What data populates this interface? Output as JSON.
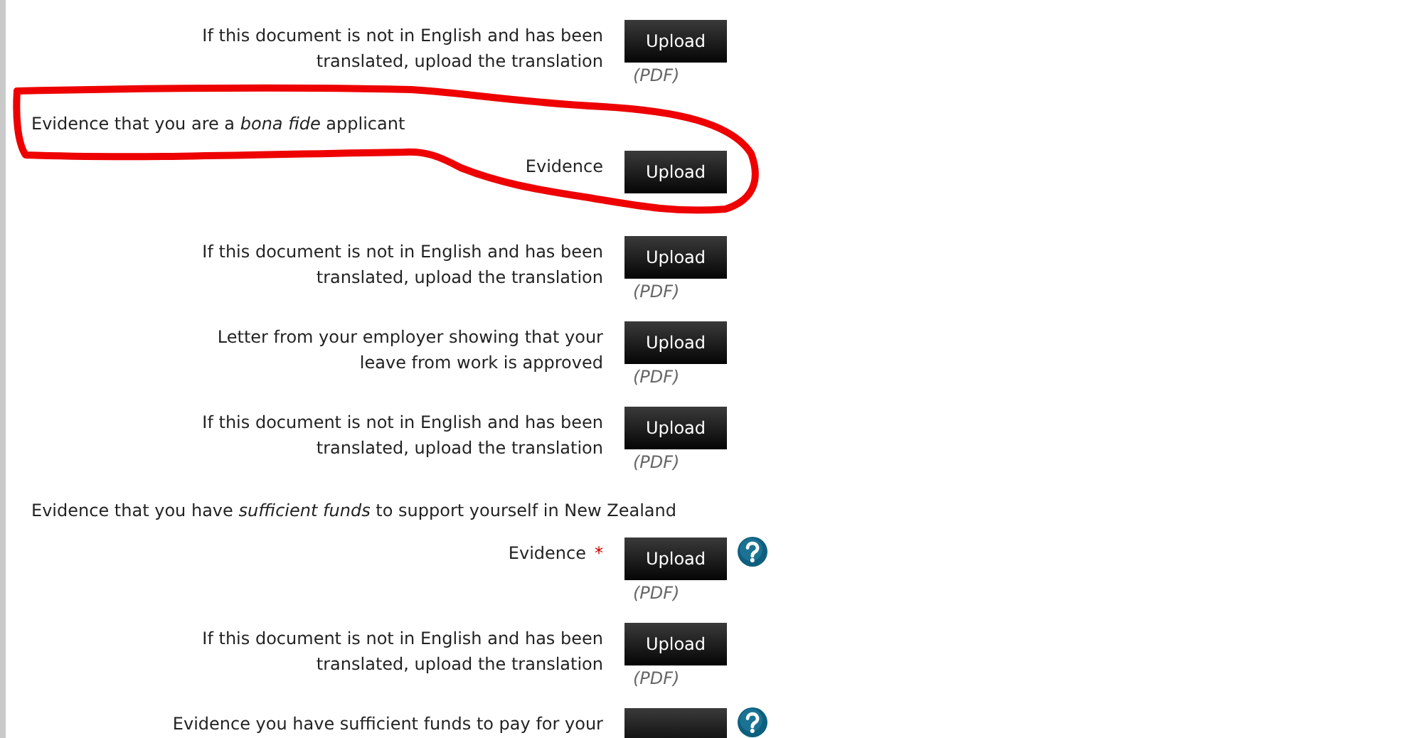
{
  "rows": [
    {
      "kind": "upload",
      "label": "If this document is not in English and has been translated, upload the translation",
      "required": false,
      "button": "Upload",
      "note": "(PDF)",
      "help": false
    },
    {
      "kind": "section",
      "text": "Evidence that you are a *bona fide* applicant"
    },
    {
      "kind": "upload",
      "label": "Evidence",
      "required": false,
      "button": "Upload",
      "help": false
    },
    {
      "kind": "upload",
      "label": "If this document is not in English and has been translated, upload the translation",
      "required": false,
      "button": "Upload",
      "note": "(PDF)",
      "help": false
    },
    {
      "kind": "upload",
      "label": "Letter from your employer showing that your leave from work is approved",
      "required": false,
      "button": "Upload",
      "note": "(PDF)",
      "help": false
    },
    {
      "kind": "upload",
      "label": "If this document is not in English and has been translated, upload the translation",
      "required": false,
      "button": "Upload",
      "note": "(PDF)",
      "help": false
    },
    {
      "kind": "section",
      "text": "Evidence that you have *sufficient funds* to support yourself in New Zealand"
    },
    {
      "kind": "upload",
      "label": "Evidence",
      "required": true,
      "required_mark": "*",
      "button": "Upload",
      "note": "(PDF)",
      "help": true
    },
    {
      "kind": "upload",
      "label": "If this document is not in English and has been translated, upload the translation",
      "required": false,
      "button": "Upload",
      "note": "(PDF)",
      "help": false
    },
    {
      "kind": "upload",
      "label": "Evidence you have sufficient funds to pay for your",
      "required": false,
      "help": true
    }
  ],
  "annotation": {
    "kind": "loop"
  }
}
